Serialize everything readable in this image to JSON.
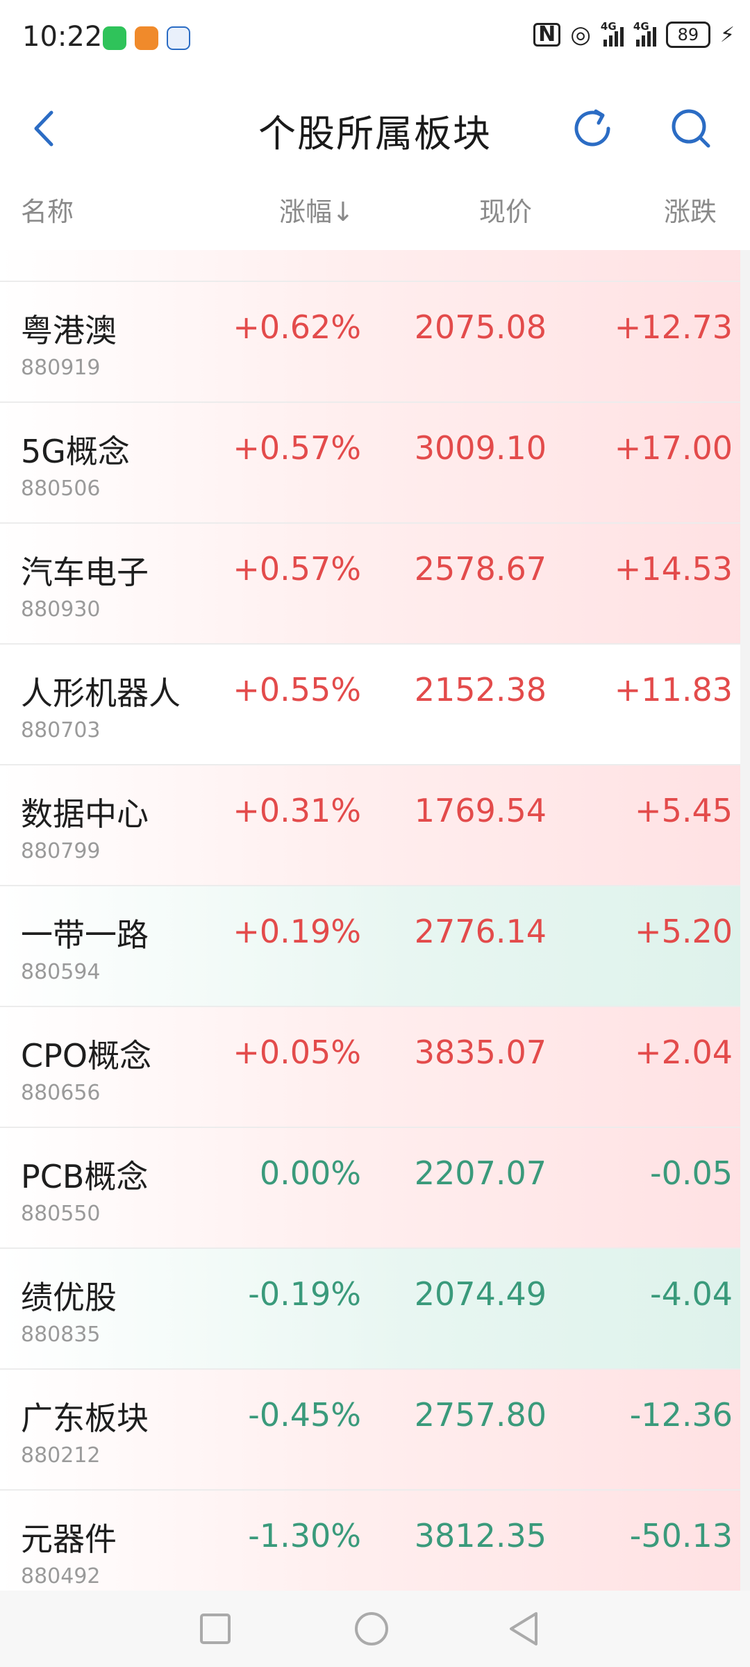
{
  "status_bar": {
    "time": "10:22",
    "signal_1_label": "4G",
    "signal_2_label": "4G",
    "battery": "89"
  },
  "header": {
    "title": "个股所属板块"
  },
  "columns": {
    "name": "名称",
    "change_pct": "涨幅↓",
    "price": "现价",
    "change": "涨跌"
  },
  "rows": [
    {
      "name": "粤港澳",
      "code": "880919",
      "pct": "+0.62%",
      "price": "2075.08",
      "chg": "+12.73"
    },
    {
      "name": "5G概念",
      "code": "880506",
      "pct": "+0.57%",
      "price": "3009.10",
      "chg": "+17.00"
    },
    {
      "name": "汽车电子",
      "code": "880930",
      "pct": "+0.57%",
      "price": "2578.67",
      "chg": "+14.53"
    },
    {
      "name": "人形机器人",
      "code": "880703",
      "pct": "+0.55%",
      "price": "2152.38",
      "chg": "+11.83"
    },
    {
      "name": "数据中心",
      "code": "880799",
      "pct": "+0.31%",
      "price": "1769.54",
      "chg": "+5.45"
    },
    {
      "name": "一带一路",
      "code": "880594",
      "pct": "+0.19%",
      "price": "2776.14",
      "chg": "+5.20"
    },
    {
      "name": "CPO概念",
      "code": "880656",
      "pct": "+0.05%",
      "price": "3835.07",
      "chg": "+2.04"
    },
    {
      "name": "PCB概念",
      "code": "880550",
      "pct": "0.00%",
      "price": "2207.07",
      "chg": "-0.05"
    },
    {
      "name": "绩优股",
      "code": "880835",
      "pct": "-0.19%",
      "price": "2074.49",
      "chg": "-4.04"
    },
    {
      "name": "广东板块",
      "code": "880212",
      "pct": "-0.45%",
      "price": "2757.80",
      "chg": "-12.36"
    },
    {
      "name": "元器件",
      "code": "880492",
      "pct": "-1.30%",
      "price": "3812.35",
      "chg": "-50.13"
    }
  ],
  "colors": {
    "up": "#e34b4b",
    "down": "#3a9a7b",
    "accent": "#2b6cc4"
  },
  "icons": {
    "back": "chevron-left-icon",
    "refresh": "refresh-icon",
    "search": "search-icon",
    "nav_recent": "square-icon",
    "nav_home": "circle-icon",
    "nav_back": "triangle-back-icon"
  }
}
